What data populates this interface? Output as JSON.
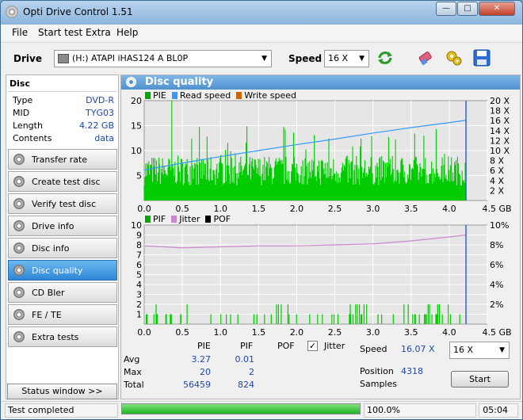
{
  "window": {
    "title": "Opti Drive Control 1.51"
  },
  "menu": [
    "File",
    "Start test",
    "Extra",
    "Help"
  ],
  "toolbar": {
    "drive_label": "Drive",
    "drive_value": "(H:)   ATAPI iHAS124   A BL0P",
    "speed_label": "Speed",
    "speed_value": "16 X"
  },
  "disc_info": {
    "header": "Disc",
    "rows": [
      {
        "key": "Type",
        "value": "DVD-R"
      },
      {
        "key": "MID",
        "value": "TYG03"
      },
      {
        "key": "Length",
        "value": "4.22 GB"
      },
      {
        "key": "Contents",
        "value": "data"
      }
    ]
  },
  "sidebar": {
    "items": [
      {
        "label": "Transfer rate",
        "active": false
      },
      {
        "label": "Create test disc",
        "active": false
      },
      {
        "label": "Verify test disc",
        "active": false
      },
      {
        "label": "Drive info",
        "active": false
      },
      {
        "label": "Disc info",
        "active": false
      },
      {
        "label": "Disc quality",
        "active": true
      },
      {
        "label": "CD Bler",
        "active": false
      },
      {
        "label": "FE / TE",
        "active": false
      },
      {
        "label": "Extra tests",
        "active": false
      }
    ],
    "status_button": "Status window >>"
  },
  "panel": {
    "title": "Disc quality"
  },
  "colors": {
    "pie": "#00cc00",
    "read_speed": "#3399ff",
    "write_speed": "#cc6600",
    "pif": "#00cc00",
    "jitter": "#cc88cc",
    "pof": "#000000",
    "marker": "#3366cc"
  },
  "chart_data": [
    {
      "type": "bar",
      "series": [
        {
          "name": "PIE",
          "typical_range": [
            3,
            9
          ],
          "peak": 20
        },
        {
          "name": "Read speed",
          "x": [
            0.0,
            0.5,
            1.0,
            1.5,
            2.0,
            2.5,
            3.0,
            3.5,
            4.0,
            4.22
          ],
          "values": [
            6.1,
            7.5,
            8.8,
            10.0,
            11.2,
            12.3,
            13.5,
            14.6,
            15.6,
            16.07
          ]
        },
        {
          "name": "Write speed",
          "values": []
        }
      ],
      "x_ticks": [
        "0.0",
        "0.5",
        "1.0",
        "1.5",
        "2.0",
        "2.5",
        "3.0",
        "3.5",
        "4.0",
        "4.5 GB"
      ],
      "y_left_ticks": [
        "20",
        "15",
        "10",
        "5"
      ],
      "y_right_ticks": [
        "20 X",
        "18 X",
        "16 X",
        "14 X",
        "12 X",
        "10 X",
        "8 X",
        "6 X",
        "4 X",
        "2 X"
      ],
      "xlim": [
        0,
        4.5
      ],
      "ylim": [
        0,
        20
      ],
      "disc_end": 4.22,
      "grid": true,
      "legend": "top-left"
    },
    {
      "type": "bar",
      "series": [
        {
          "name": "PIF",
          "max": 2
        },
        {
          "name": "Jitter",
          "x": [
            0.0,
            0.5,
            1.0,
            1.5,
            2.0,
            2.5,
            3.0,
            3.5,
            4.0,
            4.22
          ],
          "values": [
            7.9,
            7.7,
            7.8,
            7.9,
            7.9,
            8.0,
            8.1,
            8.4,
            8.8,
            9.0
          ]
        },
        {
          "name": "POF",
          "values": []
        }
      ],
      "x_ticks": [
        "0.0",
        "0.5",
        "1.0",
        "1.5",
        "2.0",
        "2.5",
        "3.0",
        "3.5",
        "4.0",
        "4.5 GB"
      ],
      "y_left_ticks": [
        "10",
        "9",
        "8",
        "7",
        "6",
        "5",
        "4",
        "3",
        "2",
        "1"
      ],
      "y_right_ticks": [
        "10%",
        "8%",
        "6%",
        "4%",
        "2%"
      ],
      "xlim": [
        0,
        4.5
      ],
      "ylim": [
        0,
        10
      ],
      "disc_end": 4.22,
      "grid": true,
      "legend": "top-left"
    }
  ],
  "stats": {
    "col_pie": "PIE",
    "col_pif": "PIF",
    "col_pof": "POF",
    "jitter_label": "Jitter",
    "jitter_checked": "✓",
    "avg_label": "Avg",
    "max_label": "Max",
    "total_label": "Total",
    "pie_avg": "3.27",
    "pif_avg": "0.01",
    "pie_max": "20",
    "pif_max": "2",
    "pie_total": "56459",
    "pif_total": "824",
    "speed_label": "Speed",
    "speed_value": "16.07 X",
    "speed_select": "16 X",
    "position_label": "Position",
    "position_value": "4318",
    "samples_label": "Samples",
    "start_button": "Start"
  },
  "statusbar": {
    "text": "Test completed",
    "progress": 100,
    "progress_text": "100.0%",
    "time": "05:04"
  }
}
